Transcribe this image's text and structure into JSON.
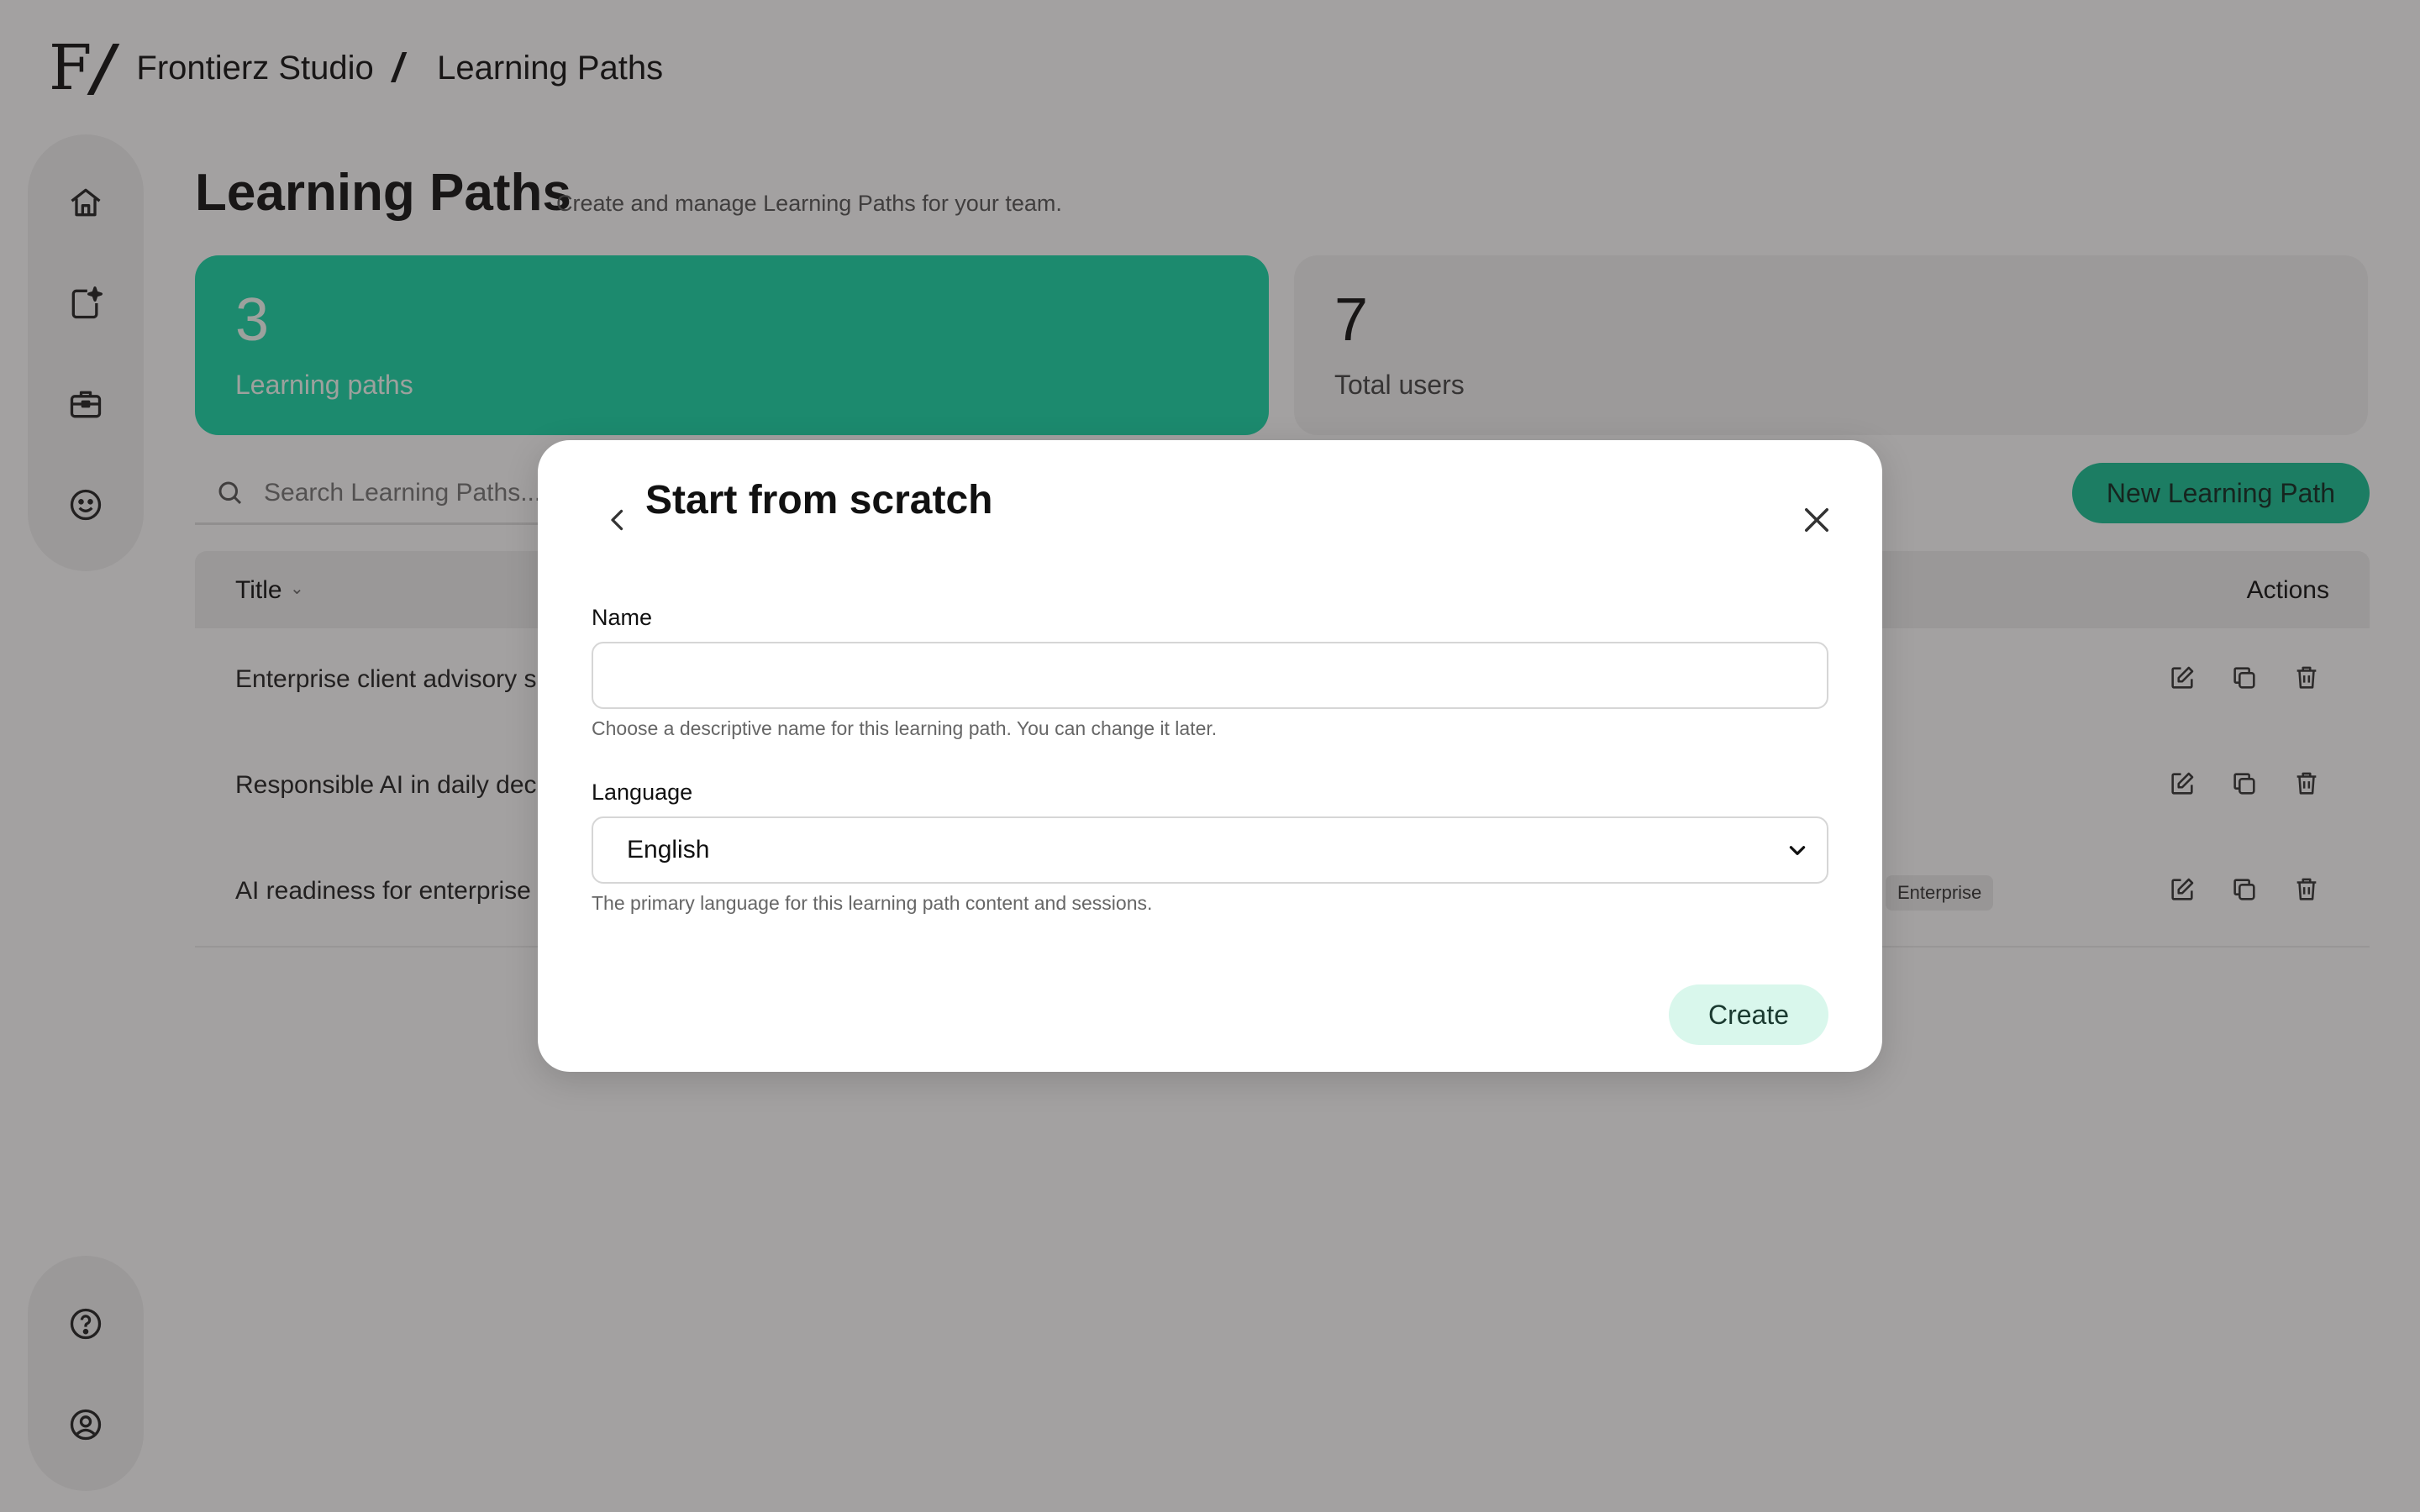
{
  "header": {
    "logo_text": "F",
    "logo_slash": "/",
    "org": "Frontierz Studio",
    "separator": "/",
    "section": "Learning Paths"
  },
  "sidebar": {
    "top_items": [
      "home-icon",
      "sparkle-document-icon",
      "briefcase-icon",
      "smiley-icon"
    ],
    "bottom_items": [
      "help-icon",
      "user-icon"
    ]
  },
  "page": {
    "title": "Learning Paths",
    "subtitle": "Create and manage Learning Paths for your team."
  },
  "stats": [
    {
      "value": "3",
      "label": "Learning paths",
      "color": "#17d8a8"
    },
    {
      "value": "7",
      "label": "Total users"
    }
  ],
  "search": {
    "placeholder": "Search Learning Paths..."
  },
  "new_button": {
    "label": "New Learning Path",
    "color": "#17c195"
  },
  "table": {
    "headers": {
      "title": "Title",
      "actions": "Actions"
    },
    "rows": [
      {
        "title": "Enterprise client advisory sin",
        "badge": ""
      },
      {
        "title": "Responsible AI in daily decisi",
        "badge": ""
      },
      {
        "title": "AI readiness for enterprise te",
        "badge": "Enterprise"
      }
    ]
  },
  "modal": {
    "title": "Start from scratch",
    "name_label": "Name",
    "name_value": "",
    "name_help": "Choose a descriptive name for this learning path. You can change it later.",
    "language_label": "Language",
    "language_value": "English",
    "language_help": "The primary language for this learning path content and sessions.",
    "create_label": "Create"
  }
}
